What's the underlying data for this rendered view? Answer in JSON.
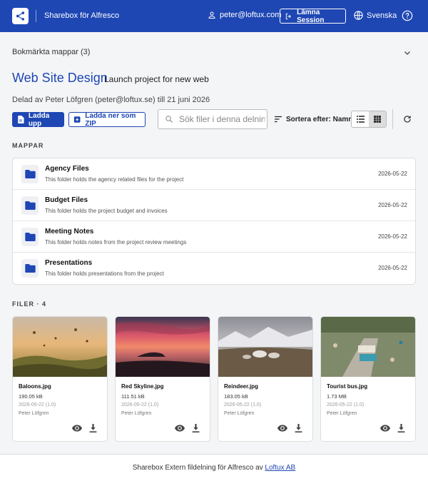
{
  "header": {
    "brand": "Sharebox för Alfresco",
    "user": "peter@loftux.com",
    "leave_label": "Lämna Session",
    "language": "Svenska"
  },
  "bookmarks": {
    "label": "Bokmärkta mappar (3)"
  },
  "page": {
    "title": "Web Site Design",
    "subtitle": "Launch project for new web",
    "shared_by": "Delad av Peter Löfgren (peter@loftux.se) till 21 juni 2026"
  },
  "toolbar": {
    "upload_label": "Ladda upp",
    "zip_label": "Ladda ner som ZIP",
    "search_placeholder": "Sök filer i denna delning",
    "sort_prefix": "Sortera efter:",
    "sort_value": "Namn"
  },
  "folders_section": {
    "label": "MAPPAR"
  },
  "folders": [
    {
      "name": "Agency Files",
      "desc": "This folder holds the agency related files for the project",
      "date": "2026-05-22"
    },
    {
      "name": "Budget Files",
      "desc": "This folder holds the project budget and invoices",
      "date": "2026-05-22"
    },
    {
      "name": "Meeting Notes",
      "desc": "This folder holds notes from the project review meetings",
      "date": "2026-05-22"
    },
    {
      "name": "Presentations",
      "desc": "This folder holds presentations from the project",
      "date": "2026-05-22"
    }
  ],
  "files_section": {
    "label": "FILER · 4"
  },
  "files": [
    {
      "name": "Baloons.jpg",
      "size": "190.05 kB",
      "date": "2026-05-22 (1.0)",
      "user": "Peter Löfgren"
    },
    {
      "name": "Red Skyline.jpg",
      "size": "111.51 kB",
      "date": "2026-05-22 (1.0)",
      "user": "Peter Löfgren"
    },
    {
      "name": "Reindeer.jpg",
      "size": "183.05 kB",
      "date": "2026-05-22 (1.0)",
      "user": "Peter Löfgren"
    },
    {
      "name": "Tourist bus.jpg",
      "size": "1.73 MB",
      "date": "2026-05-22 (1.0)",
      "user": "Peter Löfgren"
    }
  ],
  "footer": {
    "text": "Sharebox Extern fildelning för Alfresco av ",
    "link": "Loftux AB"
  },
  "colors": {
    "brand": "#1e47b4",
    "background": "#f4f5f7"
  }
}
